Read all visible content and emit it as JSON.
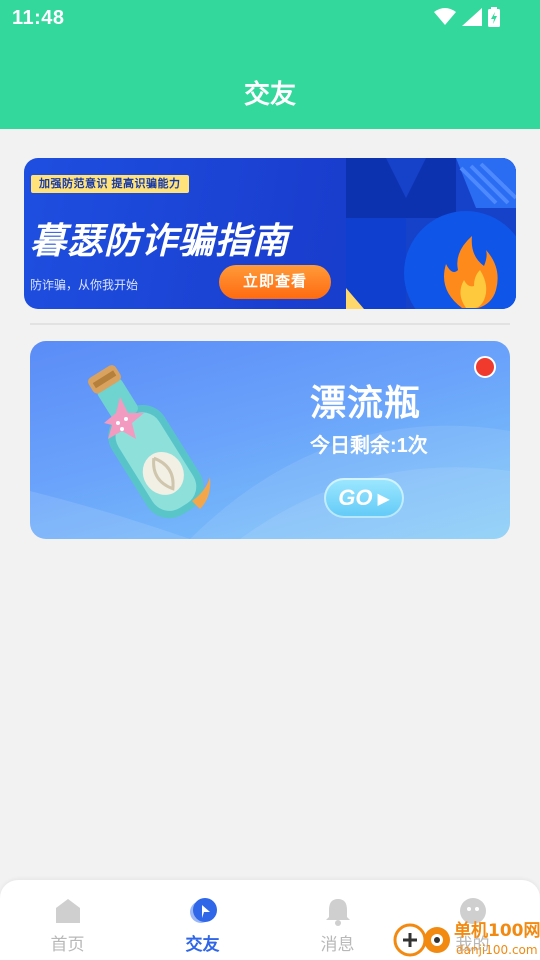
{
  "status_bar": {
    "time": "11:48"
  },
  "header": {
    "title": "交友"
  },
  "fraud_banner": {
    "badge": "加强防范意识 提高识骗能力",
    "title": "暮瑟防诈骗指南",
    "subtitle": "防诈骗，从你我开始",
    "button_label": "立即查看"
  },
  "drift_bottle": {
    "title": "漂流瓶",
    "remaining": "今日剩余:1次",
    "go_label": "GO"
  },
  "bottom_nav": {
    "items": [
      {
        "label": "首页",
        "icon": "home-icon"
      },
      {
        "label": "交友",
        "icon": "compass-icon"
      },
      {
        "label": "消息",
        "icon": "bell-icon"
      },
      {
        "label": "我的",
        "icon": "profile-icon"
      }
    ]
  },
  "watermark": {
    "brand": "单机100网",
    "url": "danji100.com"
  },
  "colors": {
    "header": "#33d89c",
    "active_nav": "#2f67e8",
    "inactive_nav": "#b8b8b8",
    "banner": "#1e4fe0",
    "button_orange": "#ff7a1f"
  }
}
